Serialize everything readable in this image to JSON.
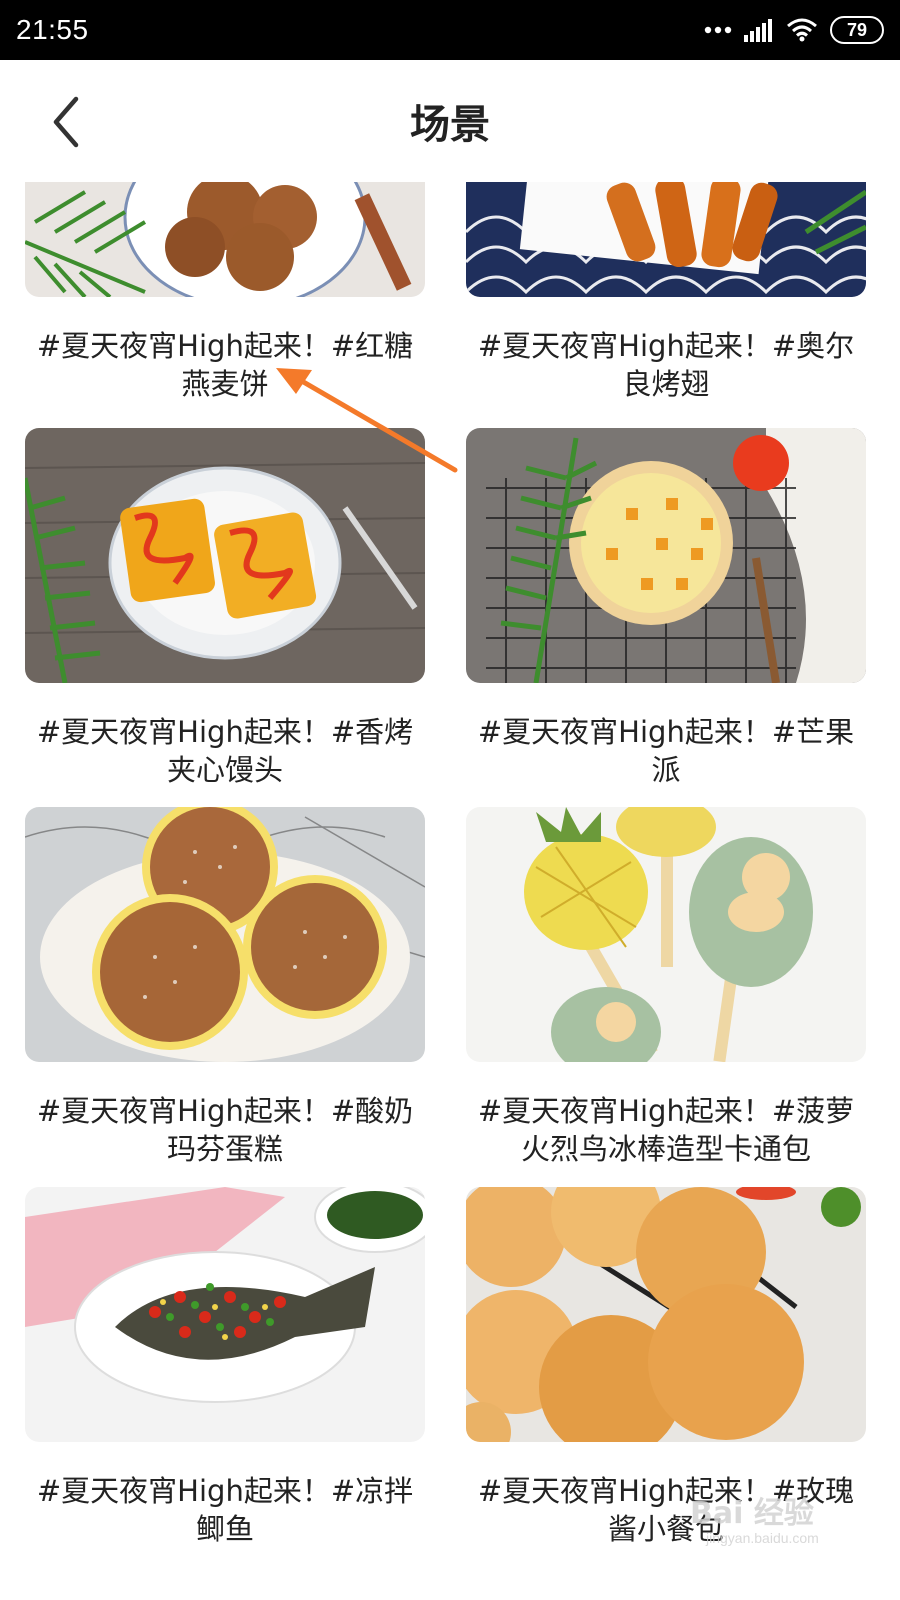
{
  "status_bar": {
    "time": "21:55",
    "battery": "79",
    "icons": [
      "dots-icon",
      "signal-icon",
      "wifi-icon",
      "battery-icon"
    ]
  },
  "header": {
    "title": "场景",
    "back_icon": "chevron-left-icon"
  },
  "recipes": [
    {
      "title": "#夏天夜宵High起来！#红糖燕麦饼"
    },
    {
      "title": "#夏天夜宵High起来！#奥尔良烤翅"
    },
    {
      "title": "#夏天夜宵High起来！#香烤夹心馒头"
    },
    {
      "title": "#夏天夜宵High起来！#芒果派"
    },
    {
      "title": "#夏天夜宵High起来！#酸奶玛芬蛋糕"
    },
    {
      "title": "#夏天夜宵High起来！#菠萝火烈鸟冰棒造型卡通包"
    },
    {
      "title": "#夏天夜宵High起来！#凉拌鲫鱼"
    },
    {
      "title": "#夏天夜宵High起来！#玫瑰酱小餐包"
    }
  ],
  "annotation": {
    "color": "#F47A2A"
  },
  "watermark": {
    "text": "Bai 经验",
    "sub": "jingyan.baidu.com"
  }
}
